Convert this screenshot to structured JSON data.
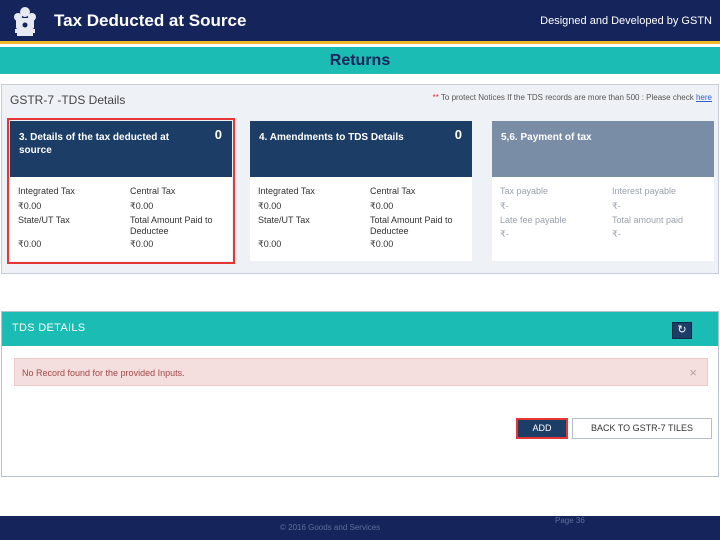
{
  "header": {
    "title": "Tax Deducted at Source",
    "credit": "Designed and Developed by GSTN"
  },
  "banner": {
    "title": "Returns"
  },
  "details": {
    "title": "GSTR-7 -TDS Details",
    "notice": {
      "star": "**",
      "text": " To protect Notices If the TDS records are more than 500 : Please check ",
      "link": "here"
    },
    "tiles": [
      {
        "title": "3. Details of the tax deducted at source",
        "count": "0",
        "selected": true,
        "fields": [
          {
            "label": "Integrated Tax",
            "value": "₹0.00"
          },
          {
            "label": "Central Tax",
            "value": "₹0.00"
          },
          {
            "label": "State/UT Tax",
            "value": "₹0.00"
          },
          {
            "label": "Total Amount Paid to Deductee",
            "value": "₹0.00"
          }
        ]
      },
      {
        "title": "4. Amendments to TDS Details",
        "count": "0",
        "selected": false,
        "fields": [
          {
            "label": "Integrated Tax",
            "value": "₹0.00"
          },
          {
            "label": "Central Tax",
            "value": "₹0.00"
          },
          {
            "label": "State/UT Tax",
            "value": "₹0.00"
          },
          {
            "label": "Total Amount Paid to Deductee",
            "value": "₹0.00"
          }
        ]
      },
      {
        "title": "5,6. Payment of tax",
        "count": "",
        "selected": false,
        "fields": [
          {
            "label": "Tax payable",
            "value": "₹-"
          },
          {
            "label": "Interest payable",
            "value": "₹-"
          },
          {
            "label": "Late fee payable",
            "value": "₹-"
          },
          {
            "label": "Total amount paid",
            "value": "₹-"
          }
        ]
      }
    ]
  },
  "tds": {
    "title": "TDS DETAILS",
    "refresh_icon": "↻",
    "alert": "No Record found for the provided Inputs.",
    "alert_close": "×",
    "add_label": "ADD",
    "back_label": "BACK TO GSTR-7 TILES"
  },
  "footer": {
    "copyright": "© 2016 Goods and Services",
    "page_number": "Page 36"
  },
  "colors": {
    "header_navy": "#15255b",
    "teal": "#1bbcb4",
    "tile_dark": "#1b3d66",
    "highlight_red": "#e53535",
    "gold": "#f0b92a"
  }
}
